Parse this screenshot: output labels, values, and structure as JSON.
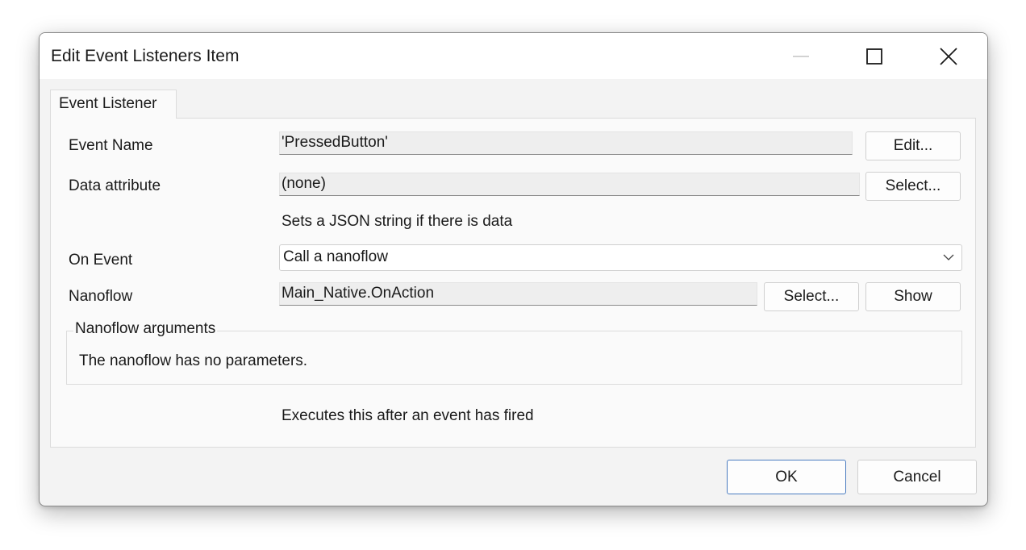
{
  "window": {
    "title": "Edit Event Listeners Item"
  },
  "titlebar_icons": {
    "minimize": "minimize-icon",
    "maximize": "maximize-icon",
    "close": "close-icon"
  },
  "tabs": [
    {
      "label": "Event Listener",
      "active": true
    }
  ],
  "form": {
    "event_name": {
      "label": "Event Name",
      "value": "'PressedButton'",
      "button": "Edit..."
    },
    "data_attribute": {
      "label": "Data attribute",
      "value": "(none)",
      "button": "Select...",
      "hint": "Sets a JSON string if there is data"
    },
    "on_event": {
      "label": "On Event",
      "value": "Call a nanoflow"
    },
    "nanoflow": {
      "label": "Nanoflow",
      "value": "Main_Native.OnAction",
      "select_button": "Select...",
      "show_button": "Show"
    },
    "arguments": {
      "title": "Nanoflow arguments",
      "text": "The nanoflow has no parameters."
    },
    "footer_hint": "Executes this after an event has fired"
  },
  "footer": {
    "ok": "OK",
    "cancel": "Cancel"
  },
  "colors": {
    "window_bg": "#f3f3f3",
    "titlebar_bg": "#ffffff",
    "panel_bg": "#fafafa",
    "field_bg": "#eeeeee",
    "ok_border": "#4a7cc0"
  }
}
